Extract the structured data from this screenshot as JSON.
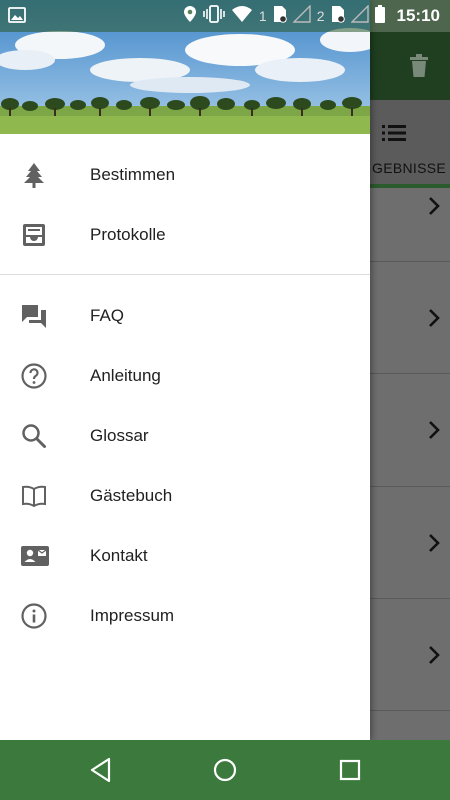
{
  "status_bar": {
    "time": "15:10",
    "sim1": "1",
    "sim2": "2",
    "icons": [
      "image-icon",
      "location-icon",
      "vibrate-icon",
      "wifi-icon",
      "sim-icon",
      "signal-icon",
      "battery-icon"
    ]
  },
  "app": {
    "tab_label": "GEBNISSE",
    "toolbar_icon": "trash-icon",
    "tab_icon": "list-icon",
    "row_icon": "chevron-right-icon"
  },
  "drawer": {
    "items_primary": [
      {
        "label": "Bestimmen",
        "icon": "tree-icon"
      },
      {
        "label": "Protokolle",
        "icon": "inbox-icon"
      }
    ],
    "items_secondary": [
      {
        "label": "FAQ",
        "icon": "forum-icon"
      },
      {
        "label": "Anleitung",
        "icon": "help-icon"
      },
      {
        "label": "Glossar",
        "icon": "search-icon"
      },
      {
        "label": "Gästebuch",
        "icon": "book-icon"
      },
      {
        "label": "Kontakt",
        "icon": "contact-card-icon"
      },
      {
        "label": "Impressum",
        "icon": "info-icon"
      }
    ]
  },
  "nav_bar": {
    "buttons": [
      "back-icon",
      "home-icon",
      "recents-icon"
    ]
  },
  "colors": {
    "status_bar": "#2b5a2c",
    "nav_bar": "#3b7a3c",
    "toolbar": "#1f3f20",
    "icon_gray": "#616161"
  }
}
